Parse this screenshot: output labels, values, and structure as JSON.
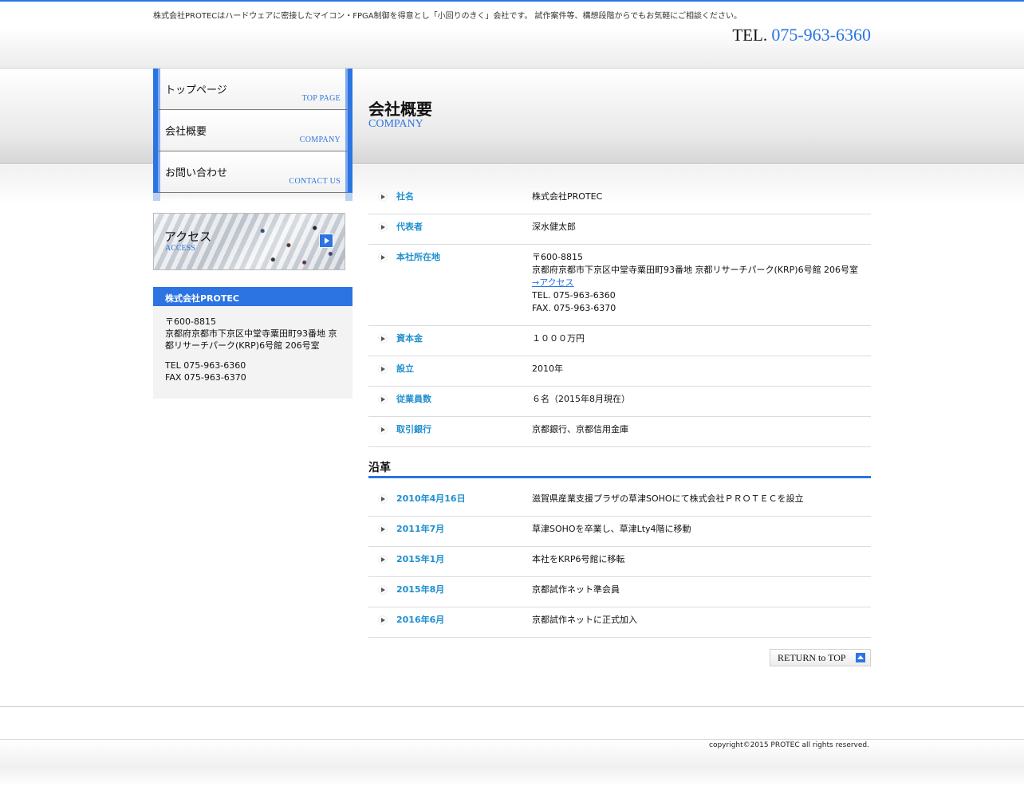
{
  "header": {
    "tagline": "株式会社PROTECはハードウェアに密接したマイコン・FPGA制御を得意とし「小回りのきく」会社です。 試作案件等、構想段階からでもお気軽にご相談ください。",
    "tel_label": "TEL.",
    "tel_number": "075-963-6360"
  },
  "nav": [
    {
      "jp": "トップページ",
      "en": "TOP PAGE"
    },
    {
      "jp": "会社概要",
      "en": "COMPANY"
    },
    {
      "jp": "お問い合わせ",
      "en": "CONTACT US"
    }
  ],
  "access": {
    "jp": "アクセス",
    "en": "ACCESS"
  },
  "company_box": {
    "title": "株式会社PROTEC",
    "zip": "〒600-8815",
    "address": "京都府京都市下京区中堂寺粟田町93番地 京都リサーチパーク(KRP)6号館 206号室",
    "tel": "TEL 075-963-6360",
    "fax": "FAX 075-963-6370"
  },
  "page": {
    "title": "会社概要",
    "subtitle": "COMPANY"
  },
  "profile": [
    {
      "k": "社名",
      "v": [
        "株式会社PROTEC"
      ]
    },
    {
      "k": "代表者",
      "v": [
        "深水健太郎"
      ]
    },
    {
      "k": "本社所在地",
      "v": [
        "〒600-8815",
        "京都府京都市下京区中堂寺粟田町93番地 京都リサーチパーク(KRP)6号館 206号室"
      ],
      "link": "→アクセス",
      "v2": [
        "TEL. 075-963-6360",
        "FAX. 075-963-6370"
      ]
    },
    {
      "k": "資本金",
      "v": [
        "１０００万円"
      ]
    },
    {
      "k": "設立",
      "v": [
        "2010年"
      ]
    },
    {
      "k": "従業員数",
      "v": [
        "６名（2015年8月現在）"
      ]
    },
    {
      "k": "取引銀行",
      "v": [
        "京都銀行、京都信用金庫"
      ]
    }
  ],
  "history_title": "沿革",
  "history": [
    {
      "k": "2010年4月16日",
      "v": "滋賀県産業支援プラザの草津SOHOにて株式会社ＰＲＯＴＥＣを設立"
    },
    {
      "k": "2011年7月",
      "v": "草津SOHOを卒業し、草津Lty4階に移動"
    },
    {
      "k": "2015年1月",
      "v": "本社をKRP6号館に移転"
    },
    {
      "k": "2015年8月",
      "v": "京都試作ネット準会員"
    },
    {
      "k": "2016年6月",
      "v": "京都試作ネットに正式加入"
    }
  ],
  "return_top": "RETURN to TOP",
  "footer": {
    "copyright": "copyright©2015 PROTEC all rights reserved."
  }
}
